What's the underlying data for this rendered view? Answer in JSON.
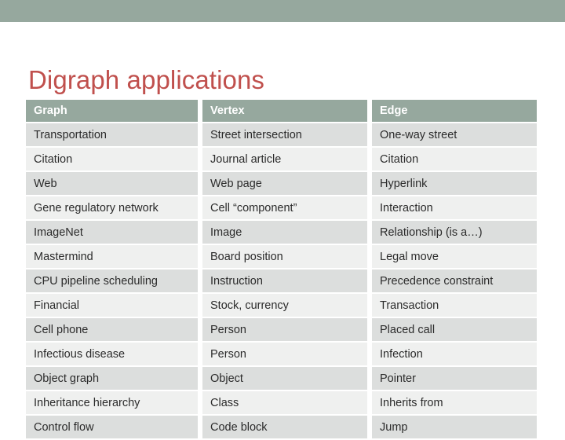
{
  "slide": {
    "title": "Digraph applications",
    "title_color": "#c0504d",
    "banner_color": "#96a89e"
  },
  "table": {
    "header_bg": "#96a89e",
    "header_text_color": "#ffffff",
    "row_dark_bg": "#dcdedd",
    "row_light_bg": "#eff0ef",
    "columns": [
      "Graph",
      "Vertex",
      "Edge"
    ],
    "rows": [
      [
        "Transportation",
        "Street intersection",
        "One-way street"
      ],
      [
        "Citation",
        "Journal article",
        "Citation"
      ],
      [
        "Web",
        "Web page",
        "Hyperlink"
      ],
      [
        "Gene regulatory network",
        "Cell “component”",
        "Interaction"
      ],
      [
        "ImageNet",
        "Image",
        "Relationship (is a…)"
      ],
      [
        "Mastermind",
        "Board position",
        "Legal move"
      ],
      [
        "CPU pipeline scheduling",
        "Instruction",
        "Precedence constraint"
      ],
      [
        "Financial",
        "Stock, currency",
        "Transaction"
      ],
      [
        "Cell phone",
        "Person",
        "Placed call"
      ],
      [
        "Infectious disease",
        "Person",
        "Infection"
      ],
      [
        "Object graph",
        "Object",
        "Pointer"
      ],
      [
        "Inheritance hierarchy",
        "Class",
        "Inherits from"
      ],
      [
        "Control flow",
        "Code block",
        "Jump"
      ]
    ]
  }
}
